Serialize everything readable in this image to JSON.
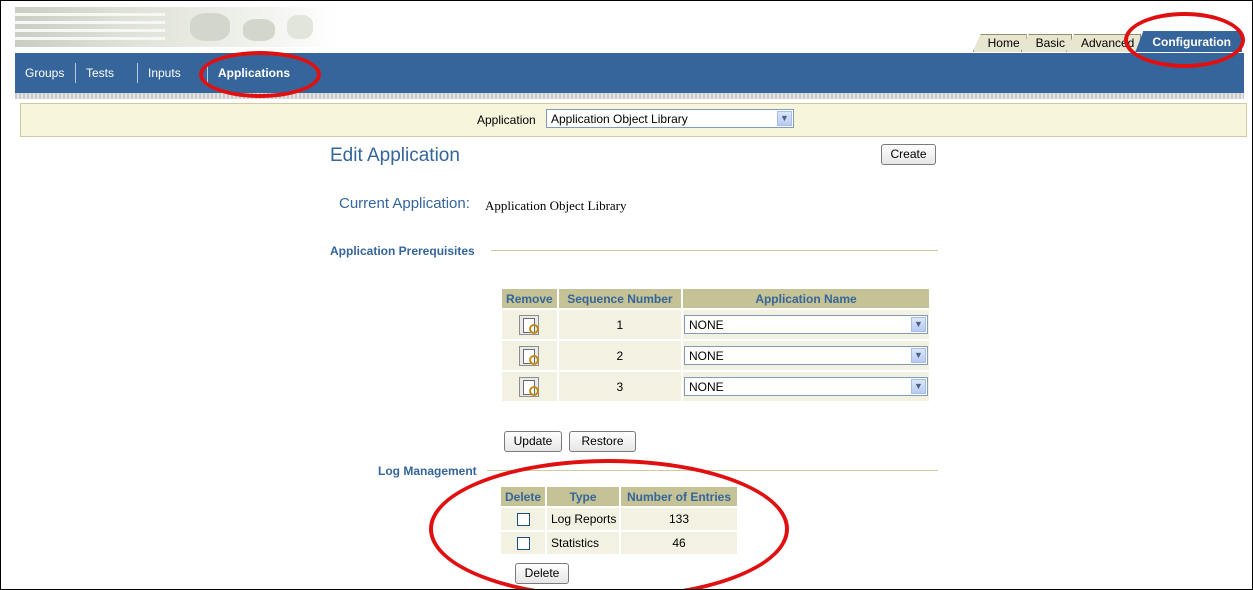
{
  "top_tabs": [
    "Home",
    "Basic",
    "Advanced",
    "Configuration"
  ],
  "sub_tabs": [
    "Groups",
    "Tests",
    "Inputs",
    "Applications"
  ],
  "application_filter": {
    "label": "Application",
    "selected": "Application Object Library"
  },
  "page_title": "Edit Application",
  "create_label": "Create",
  "current_application": {
    "label": "Current Application:",
    "value": "Application Object Library"
  },
  "prerequisites": {
    "section_title": "Application Prerequisites",
    "headers": [
      "Remove",
      "Sequence Number",
      "Application Name"
    ],
    "rows": [
      {
        "sequence": "1",
        "application": "NONE"
      },
      {
        "sequence": "2",
        "application": "NONE"
      },
      {
        "sequence": "3",
        "application": "NONE"
      }
    ],
    "update_label": "Update",
    "restore_label": "Restore"
  },
  "log_management": {
    "section_title": "Log Management",
    "headers": [
      "Delete",
      "Type",
      "Number of Entries"
    ],
    "rows": [
      {
        "type": "Log Reports",
        "entries": "133"
      },
      {
        "type": "Statistics",
        "entries": "46"
      }
    ],
    "delete_label": "Delete"
  },
  "colors": {
    "nav_blue": "#35659b",
    "header_tan": "#c5c295",
    "annotation_red": "#e01010"
  }
}
